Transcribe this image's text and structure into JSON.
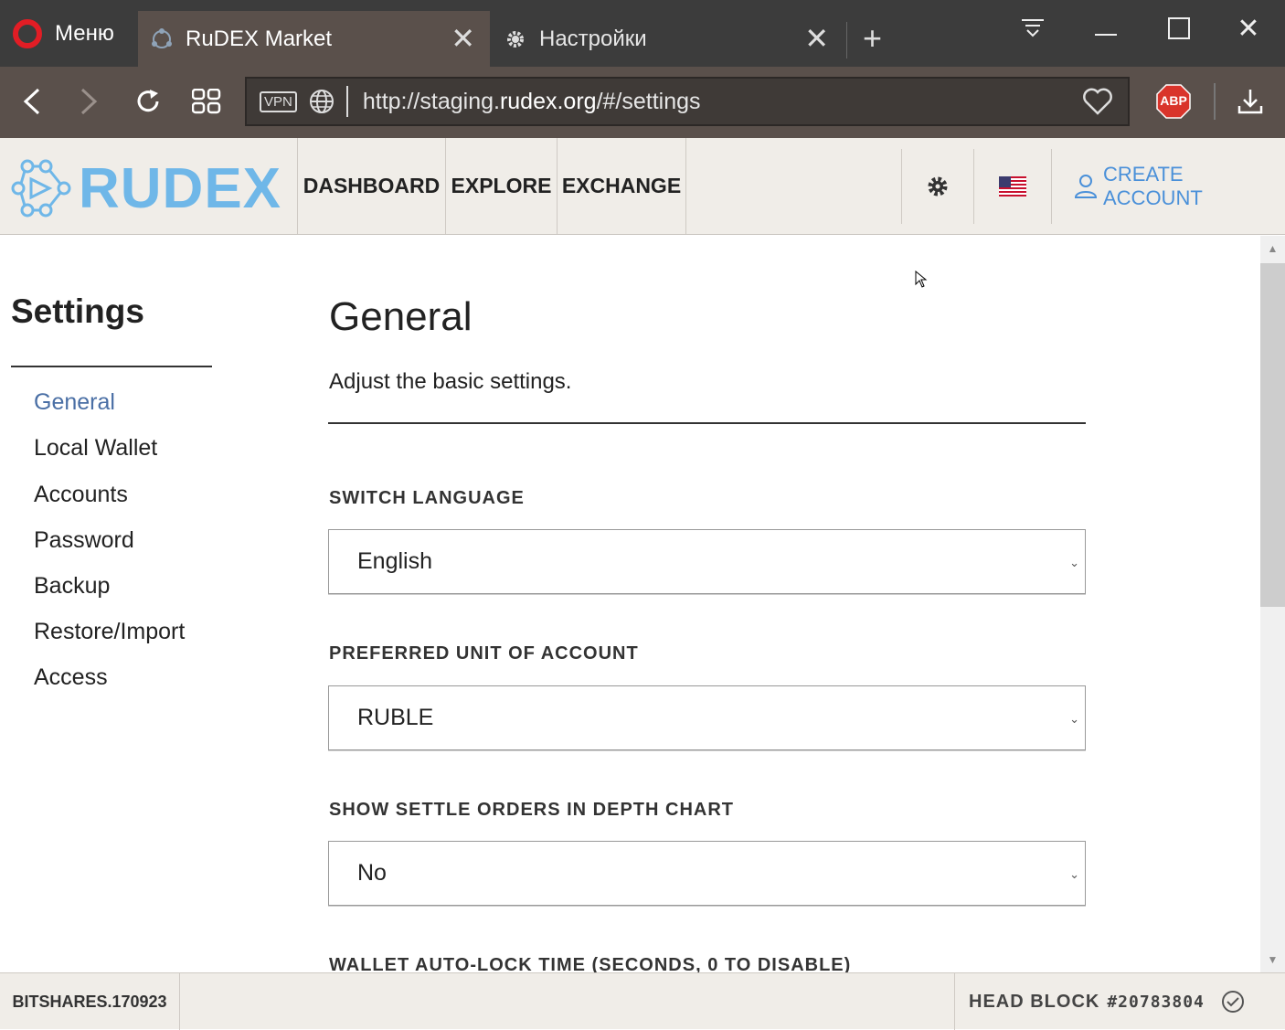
{
  "browser": {
    "menu_label": "Меню",
    "tabs": [
      {
        "title": "RuDEX Market"
      },
      {
        "title": "Настройки"
      }
    ],
    "vpn_label": "VPN",
    "url_prefix": "http://staging.",
    "url_domain": "rudex.org",
    "url_suffix": "/#/settings",
    "abp_label": "ABP"
  },
  "header": {
    "logo_text": "RUDEX",
    "nav": [
      "DASHBOARD",
      "EXPLORE",
      "EXCHANGE"
    ],
    "create_account": "CREATE ACCOUNT"
  },
  "sidebar": {
    "title": "Settings",
    "items": [
      {
        "label": "General"
      },
      {
        "label": "Local Wallet"
      },
      {
        "label": "Accounts"
      },
      {
        "label": "Password"
      },
      {
        "label": "Backup"
      },
      {
        "label": "Restore/Import"
      },
      {
        "label": "Access"
      }
    ]
  },
  "main": {
    "title": "General",
    "description": "Adjust the basic settings.",
    "fields": [
      {
        "label": "SWITCH LANGUAGE",
        "value": "English"
      },
      {
        "label": "PREFERRED UNIT OF ACCOUNT",
        "value": "RUBLE"
      },
      {
        "label": "SHOW SETTLE ORDERS IN DEPTH CHART",
        "value": "No"
      },
      {
        "label": "WALLET AUTO-LOCK TIME (SECONDS, 0 TO DISABLE)"
      }
    ]
  },
  "footer": {
    "version": "BITSHARES.170923",
    "head_block_label": "HEAD BLOCK",
    "head_block_num": "#20783804"
  },
  "colors": {
    "brand": "#6fb7e8",
    "active_link": "#4a6fa5",
    "create_account": "#4a90d9",
    "opera_red": "#e21d25"
  }
}
